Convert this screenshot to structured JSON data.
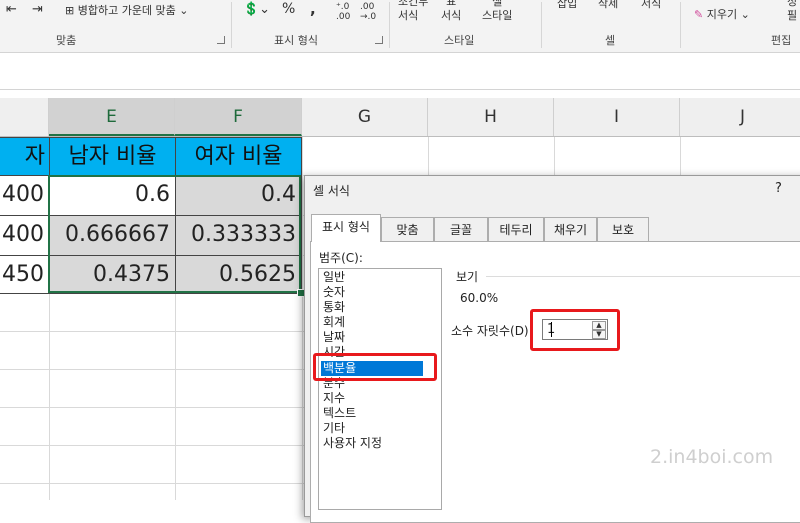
{
  "ribbon": {
    "align_group": {
      "merge_label": "병합하고 가운데 맞춤",
      "group_label": "맞춤"
    },
    "number_group": {
      "percent_symbol": "%",
      "comma_symbol": ",",
      "group_label": "표시 형식"
    },
    "styles_group": {
      "conditional_label": "조건부\n서식",
      "table_label": "표\n서식",
      "cell_style_label": "셀\n스타일",
      "group_label": "스타일"
    },
    "cells_group": {
      "insert_label": "삽입",
      "delete_label": "삭제",
      "format_label": "서식",
      "group_label": "셀"
    },
    "editing_group": {
      "clear_label": "지우기",
      "sort_label": "정\n필",
      "group_label": "편집"
    }
  },
  "sheet": {
    "columns": [
      "E",
      "F",
      "G",
      "H",
      "I",
      "J"
    ],
    "partial_header": "자",
    "headers": [
      "남자 비율",
      "여자 비율"
    ],
    "rows": [
      {
        "d": "400",
        "e": "0.6",
        "f": "0.4"
      },
      {
        "d": "400",
        "e": "0.666667",
        "f": "0.333333"
      },
      {
        "d": "450",
        "e": "0.4375",
        "f": "0.5625"
      }
    ]
  },
  "dialog": {
    "title": "셀 서식",
    "help": "?",
    "tabs": [
      "표시 형식",
      "맞춤",
      "글꼴",
      "테두리",
      "채우기",
      "보호"
    ],
    "active_tab": 0,
    "category_label": "범주(C):",
    "categories": [
      "일반",
      "숫자",
      "통화",
      "회계",
      "날짜",
      "시간",
      "백분율",
      "분수",
      "지수",
      "텍스트",
      "기타",
      "사용자 지정"
    ],
    "selected_category": 6,
    "sample_label": "보기",
    "sample_value": "60.0%",
    "decimal_label": "소수 자릿수(D):",
    "decimal_value": "1"
  },
  "watermark": "2.in4boi.com",
  "colors": {
    "header_fill": "#00b0f0",
    "selection": "#0078d7",
    "highlight_box": "#e8191c",
    "excel_green": "#217346"
  }
}
